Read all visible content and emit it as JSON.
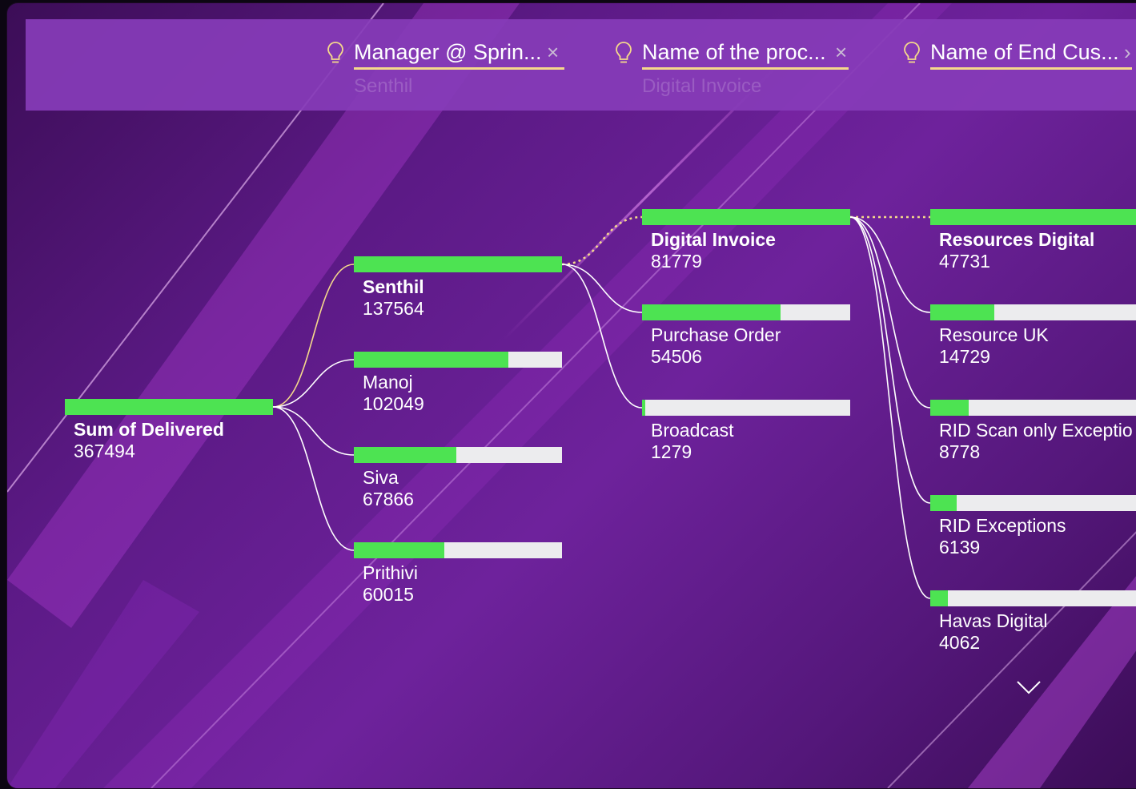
{
  "header": {
    "levels": [
      {
        "title": "Manager @ Sprin...",
        "selected": "Senthil",
        "close_icon": "close-icon"
      },
      {
        "title": "Name of the proc...",
        "selected": "Digital Invoice",
        "close_icon": "close-icon"
      },
      {
        "title": "Name of End Cus...",
        "selected": "",
        "close_icon": "chevron-right-icon"
      }
    ],
    "close_glyph": "×",
    "next_glyph": "›"
  },
  "colors": {
    "bar_fill": "#4de352",
    "bar_track": "#ececee",
    "selected_path": "#f5d98b",
    "connector": "#ffffff"
  },
  "chart_data": {
    "type": "decomposition-tree",
    "root": {
      "label": "Sum of Delivered",
      "value": 367494
    },
    "levels": [
      {
        "field": "Manager @ Sprin...",
        "nodes": [
          {
            "label": "Senthil",
            "value": 137564,
            "selected": true
          },
          {
            "label": "Manoj",
            "value": 102049
          },
          {
            "label": "Siva",
            "value": 67866
          },
          {
            "label": "Prithivi",
            "value": 60015
          }
        ]
      },
      {
        "field": "Name of the proc...",
        "nodes": [
          {
            "label": "Digital Invoice",
            "value": 81779,
            "selected": true
          },
          {
            "label": "Purchase Order",
            "value": 54506
          },
          {
            "label": "Broadcast",
            "value": 1279
          }
        ]
      },
      {
        "field": "Name of End Cus...",
        "nodes": [
          {
            "label": "Resources Digital",
            "value": 47731,
            "selected": true
          },
          {
            "label": "Resource UK",
            "value": 14729
          },
          {
            "label": "RID Scan only Exceptio",
            "value": 8778
          },
          {
            "label": "RID Exceptions",
            "value": 6139
          },
          {
            "label": "Havas Digital",
            "value": 4062
          }
        ]
      }
    ]
  }
}
